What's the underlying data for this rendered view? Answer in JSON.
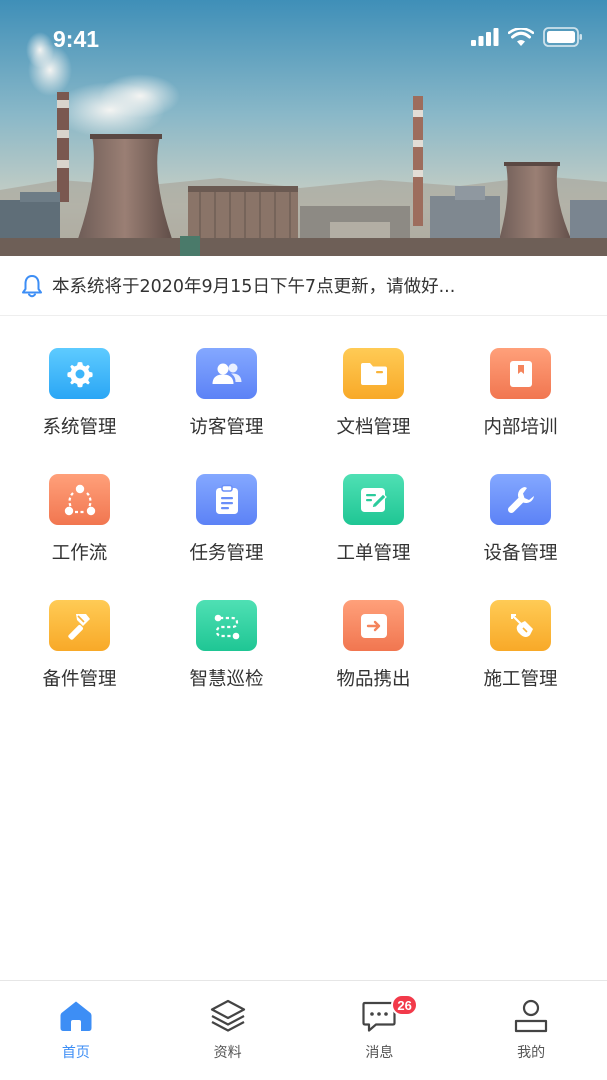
{
  "status_bar": {
    "time": "9:41"
  },
  "notice": {
    "text": "本系统将于2020年9月15日下午7点更新，请做好..."
  },
  "modules": [
    {
      "label": "系统管理",
      "icon": "gear-icon",
      "colors": [
        "#5ecbff",
        "#2aa6f5"
      ]
    },
    {
      "label": "访客管理",
      "icon": "users-icon",
      "colors": [
        "#84a8ff",
        "#5c82f6"
      ]
    },
    {
      "label": "文档管理",
      "icon": "folder-icon",
      "colors": [
        "#ffcb55",
        "#f8a928"
      ]
    },
    {
      "label": "内部培训",
      "icon": "book-icon",
      "colors": [
        "#ffa07a",
        "#f17650"
      ]
    },
    {
      "label": "工作流",
      "icon": "workflow-icon",
      "colors": [
        "#ffa07a",
        "#f17650"
      ]
    },
    {
      "label": "任务管理",
      "icon": "clipboard-icon",
      "colors": [
        "#84a8ff",
        "#5c82f6"
      ]
    },
    {
      "label": "工单管理",
      "icon": "work-order-icon",
      "colors": [
        "#4fe0b4",
        "#1fc694"
      ]
    },
    {
      "label": "设备管理",
      "icon": "wrench-icon",
      "colors": [
        "#84a8ff",
        "#5c82f6"
      ]
    },
    {
      "label": "备件管理",
      "icon": "hammer-icon",
      "colors": [
        "#ffcb55",
        "#f8a928"
      ]
    },
    {
      "label": "智慧巡检",
      "icon": "route-icon",
      "colors": [
        "#4fe0b4",
        "#1fc694"
      ]
    },
    {
      "label": "物品携出",
      "icon": "export-icon",
      "colors": [
        "#ffa07a",
        "#f17650"
      ]
    },
    {
      "label": "施工管理",
      "icon": "shovel-icon",
      "colors": [
        "#ffcb55",
        "#f8a928"
      ]
    }
  ],
  "tabs": [
    {
      "label": "首页",
      "icon": "home-icon",
      "active": true
    },
    {
      "label": "资料",
      "icon": "layers-icon",
      "active": false
    },
    {
      "label": "消息",
      "icon": "message-icon",
      "active": false,
      "badge": "26"
    },
    {
      "label": "我的",
      "icon": "user-icon",
      "active": false
    }
  ],
  "colors": {
    "accent": "#3d8ef5",
    "badge": "#f23a4a"
  }
}
